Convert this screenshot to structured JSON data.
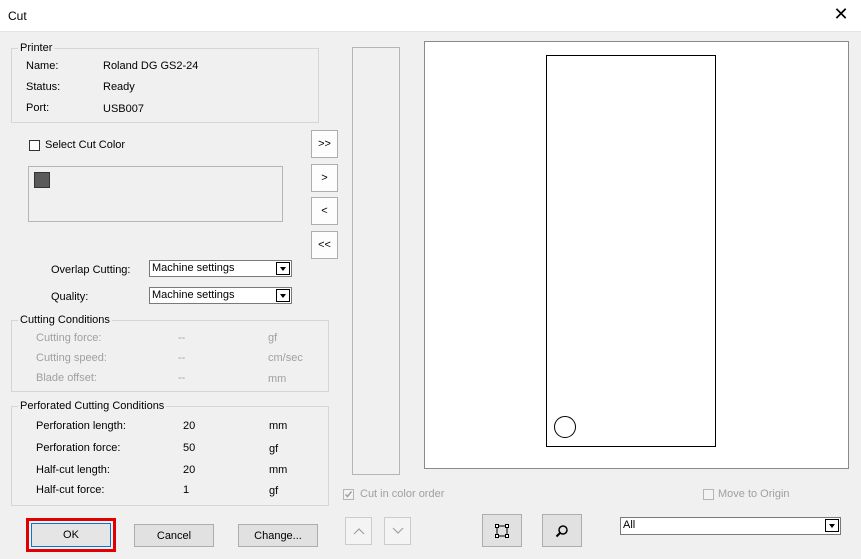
{
  "window": {
    "title": "Cut",
    "close_label": "✕"
  },
  "printer": {
    "legend": "Printer",
    "rows": [
      {
        "label": "Name:",
        "value": "Roland DG GS2-24"
      },
      {
        "label": "Status:",
        "value": "Ready"
      },
      {
        "label": "Port:",
        "value": "USB007"
      }
    ]
  },
  "select_cut_color": {
    "label": "Select Cut Color",
    "checked": false,
    "swatch_color": "#5a5a5a"
  },
  "move_buttons": [
    ">>",
    ">",
    "<",
    "<<"
  ],
  "overlap": {
    "label": "Overlap Cutting:",
    "value": "Machine settings"
  },
  "quality": {
    "label": "Quality:",
    "value": "Machine settings"
  },
  "cutting_conditions": {
    "legend": "Cutting Conditions",
    "rows": [
      {
        "label": "Cutting force:",
        "value": "--",
        "unit": "gf"
      },
      {
        "label": "Cutting speed:",
        "value": "--",
        "unit": "cm/sec"
      },
      {
        "label": "Blade offset:",
        "value": "--",
        "unit": "mm"
      }
    ]
  },
  "perforated": {
    "legend": "Perforated Cutting Conditions",
    "rows": [
      {
        "label": "Perforation length:",
        "value": "20",
        "unit": "mm"
      },
      {
        "label": "Perforation  force:",
        "value": "50",
        "unit": "gf"
      },
      {
        "label": "Half-cut length:",
        "value": "20",
        "unit": "mm"
      },
      {
        "label": "Half-cut force:",
        "value": "1",
        "unit": "gf"
      }
    ]
  },
  "cut_in_color_order": {
    "label": "Cut in color order",
    "checked": true
  },
  "move_to_origin": {
    "label": "Move to Origin",
    "checked": false
  },
  "buttons": {
    "ok": "OK",
    "cancel": "Cancel",
    "change": "Change..."
  },
  "view_select": {
    "value": "All"
  },
  "colors": {
    "ok_highlight": "#e00000"
  }
}
